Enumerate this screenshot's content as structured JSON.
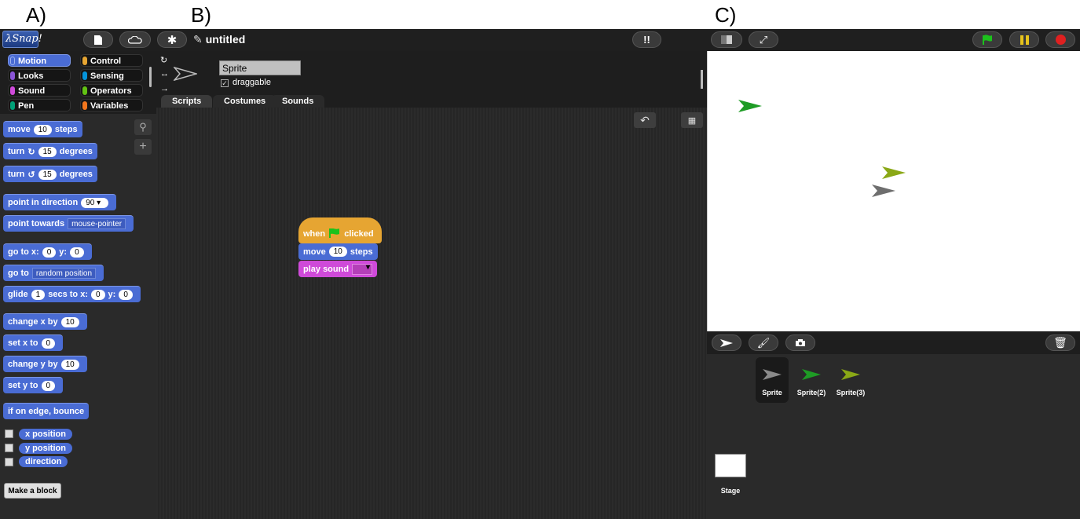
{
  "panel_labels": [
    "A)",
    "B)",
    "C)"
  ],
  "app": {
    "logo": "λSnap!",
    "project_title": "untitled"
  },
  "categories": [
    {
      "label": "Motion",
      "color": "#4a6cd4",
      "selected": true
    },
    {
      "label": "Control",
      "color": "#e6a532",
      "selected": false
    },
    {
      "label": "Looks",
      "color": "#8a55d7",
      "selected": false
    },
    {
      "label": "Sensing",
      "color": "#0494dc",
      "selected": false
    },
    {
      "label": "Sound",
      "color": "#cf4ad9",
      "selected": false
    },
    {
      "label": "Operators",
      "color": "#62c213",
      "selected": false
    },
    {
      "label": "Pen",
      "color": "#00a178",
      "selected": false
    },
    {
      "label": "Variables",
      "color": "#f3761d",
      "selected": false
    }
  ],
  "palette": {
    "move": {
      "a": "move",
      "v": "10",
      "b": "steps"
    },
    "turn_cw": {
      "a": "turn",
      "v": "15",
      "b": "degrees"
    },
    "turn_ccw": {
      "a": "turn",
      "v": "15",
      "b": "degrees"
    },
    "point_dir": {
      "a": "point in direction",
      "v": "90"
    },
    "point_towards": {
      "a": "point towards",
      "v": "mouse-pointer"
    },
    "goto_xy": {
      "a": "go to x:",
      "x": "0",
      "b": "y:",
      "y": "0"
    },
    "goto": {
      "a": "go to",
      "v": "random position"
    },
    "glide": {
      "a": "glide",
      "s": "1",
      "b": "secs to x:",
      "x": "0",
      "c": "y:",
      "y": "0"
    },
    "change_x": {
      "a": "change x by",
      "v": "10"
    },
    "set_x": {
      "a": "set x to",
      "v": "0"
    },
    "change_y": {
      "a": "change y by",
      "v": "10"
    },
    "set_y": {
      "a": "set y to",
      "v": "0"
    },
    "bounce": "if on edge, bounce",
    "reporters": [
      "x position",
      "y position",
      "direction"
    ],
    "make_block": "Make a block"
  },
  "sprite": {
    "name": "Sprite",
    "draggable_label": "draggable",
    "draggable": true
  },
  "tabs": [
    "Scripts",
    "Costumes",
    "Sounds"
  ],
  "script": {
    "hat": {
      "a": "when",
      "b": "clicked"
    },
    "move": {
      "a": "move",
      "v": "10",
      "b": "steps"
    },
    "sound": {
      "a": "play sound"
    }
  },
  "stage_sprites": [
    {
      "color": "#1e9c25"
    },
    {
      "color": "#8aa816"
    },
    {
      "color": "#6e6e6e"
    }
  ],
  "corral": {
    "sprites": [
      "Sprite",
      "Sprite(2)",
      "Sprite(3)"
    ],
    "stage_label": "Stage"
  },
  "colors": {
    "motion": "#4a6cd4",
    "control": "#e6a532",
    "sound": "#cf4ad9",
    "green_flag": "#1cc21c",
    "pause": "#e6c31c",
    "stop": "#e02020"
  }
}
